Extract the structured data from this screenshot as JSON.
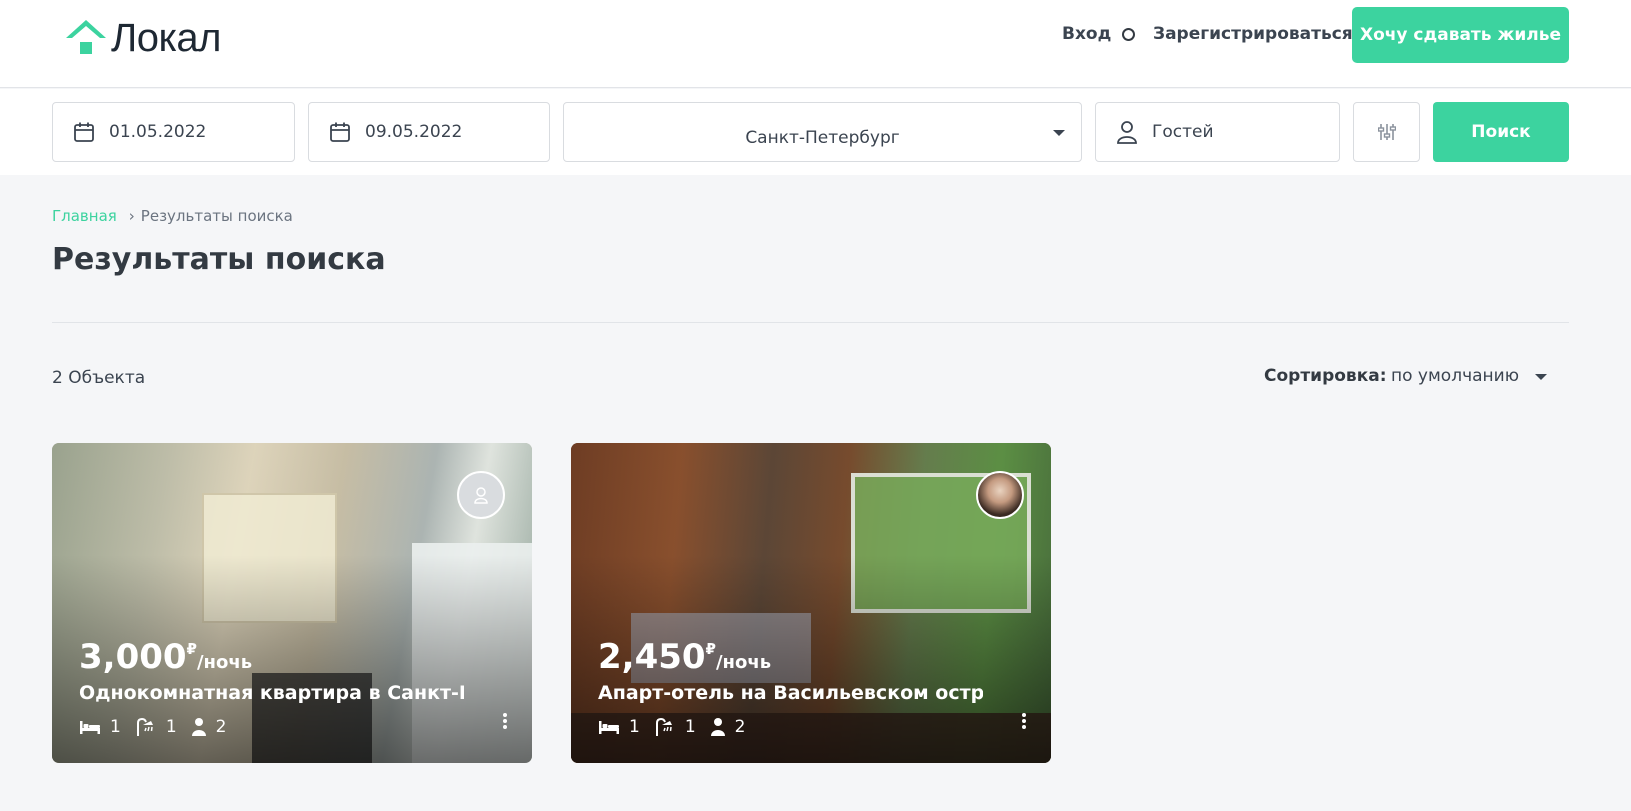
{
  "brand": {
    "name": "Локал",
    "accent": "#3cd39f"
  },
  "nav": {
    "login": "Вход",
    "register": "Зарегистрироваться",
    "host_button": "Хочу сдавать жилье"
  },
  "search": {
    "check_in": "01.05.2022",
    "check_out": "09.05.2022",
    "city": "Санкт-Петербург",
    "guests_placeholder": "Гостей",
    "submit": "Поиск"
  },
  "breadcrumb": {
    "home": "Главная",
    "separator": "›",
    "current": "Результаты поиска"
  },
  "page": {
    "title": "Результаты поиска"
  },
  "results": {
    "count": "2 Объекта",
    "sort_label": "Сортировка:",
    "sort_value": "по умолчанию"
  },
  "listings": [
    {
      "price": "3,000",
      "currency": "₽",
      "unit": "/ночь",
      "title": "Однокомнатная квартира в Санкт-Петербурге",
      "beds": "1",
      "baths": "1",
      "guests": "2"
    },
    {
      "price": "2,450",
      "currency": "₽",
      "unit": "/ночь",
      "title": "Апарт-отель на Васильевском острове",
      "beds": "1",
      "baths": "1",
      "guests": "2"
    }
  ]
}
